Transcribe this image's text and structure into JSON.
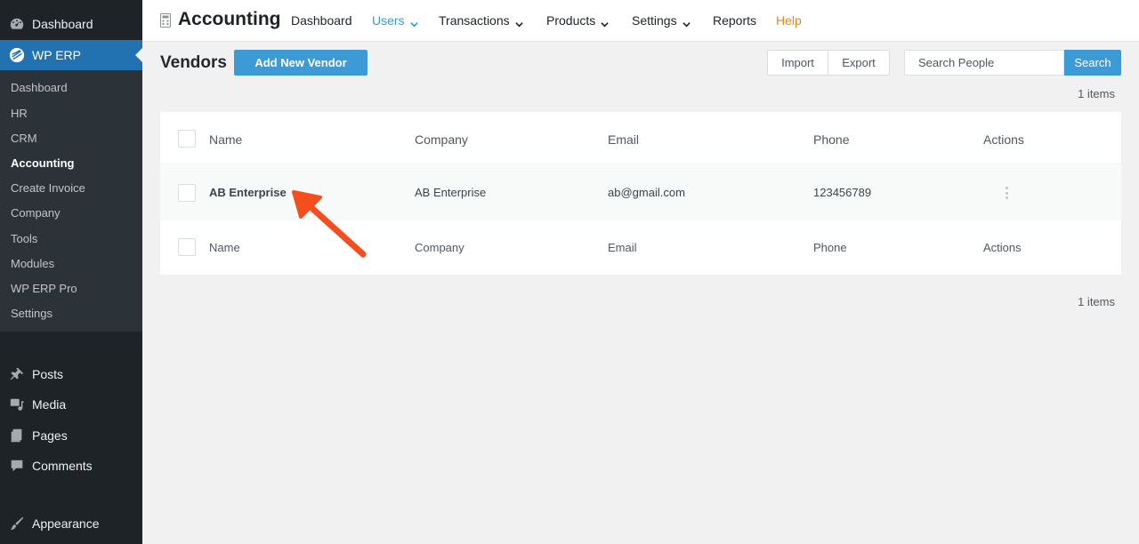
{
  "sidebar": {
    "dashboard": "Dashboard",
    "wp_erp": "WP ERP",
    "submenu": [
      "Dashboard",
      "HR",
      "CRM",
      "Accounting",
      "Create Invoice",
      "Company",
      "Tools",
      "Modules",
      "WP ERP Pro",
      "Settings"
    ],
    "active_submenu": "Accounting",
    "posts": "Posts",
    "media": "Media",
    "pages": "Pages",
    "comments": "Comments",
    "appearance": "Appearance"
  },
  "topbar": {
    "title": "Accounting",
    "nav": {
      "dashboard": "Dashboard",
      "users": "Users",
      "transactions": "Transactions",
      "products": "Products",
      "settings": "Settings",
      "reports": "Reports",
      "help": "Help"
    }
  },
  "page": {
    "title": "Vendors",
    "add_button": "Add New Vendor",
    "import_button": "Import",
    "export_button": "Export",
    "search_placeholder": "Search People",
    "search_button": "Search",
    "items_count": "1 items"
  },
  "table": {
    "columns": {
      "name": "Name",
      "company": "Company",
      "email": "Email",
      "phone": "Phone",
      "actions": "Actions"
    },
    "rows": [
      {
        "name": "AB Enterprise",
        "company": "AB Enterprise",
        "email": "ab@gmail.com",
        "phone": "123456789"
      }
    ]
  },
  "colors": {
    "accent": "#3c9bd6",
    "link": "#2e9fd1",
    "help": "#e8870e",
    "sidebar_bg": "#1d2327",
    "annotation_arrow": "#f24e1e"
  }
}
